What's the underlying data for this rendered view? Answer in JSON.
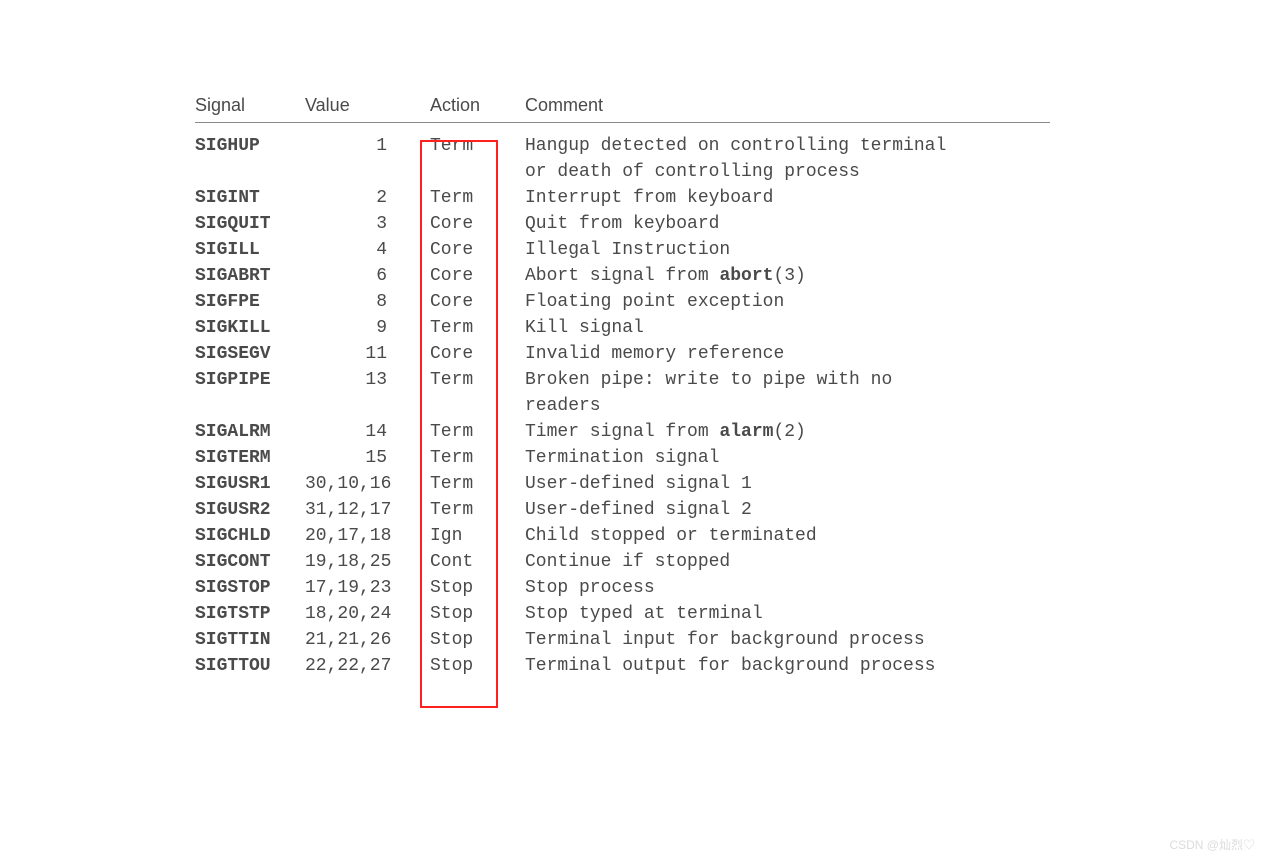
{
  "headers": {
    "signal": "Signal",
    "value": "Value",
    "action": "Action",
    "comment": "Comment"
  },
  "rows": [
    {
      "signal": "SIGHUP",
      "value": "1",
      "value_align": "right",
      "action": "Term",
      "comment_pre": "Hangup detected on controlling terminal",
      "comment_cont": "or death of controlling process"
    },
    {
      "signal": "SIGINT",
      "value": "2",
      "value_align": "right",
      "action": "Term",
      "comment_pre": "Interrupt from keyboard"
    },
    {
      "signal": "SIGQUIT",
      "value": "3",
      "value_align": "right",
      "action": "Core",
      "comment_pre": "Quit from keyboard"
    },
    {
      "signal": "SIGILL",
      "value": "4",
      "value_align": "right",
      "action": "Core",
      "comment_pre": "Illegal Instruction"
    },
    {
      "signal": "SIGABRT",
      "value": "6",
      "value_align": "right",
      "action": "Core",
      "comment_pre": "Abort signal from ",
      "bold": "abort",
      "comment_post": "(3)"
    },
    {
      "signal": "SIGFPE",
      "value": "8",
      "value_align": "right",
      "action": "Core",
      "comment_pre": "Floating point exception"
    },
    {
      "signal": "SIGKILL",
      "value": "9",
      "value_align": "right",
      "action": "Term",
      "comment_pre": "Kill signal"
    },
    {
      "signal": "SIGSEGV",
      "value": "11",
      "value_align": "right",
      "action": "Core",
      "comment_pre": "Invalid memory reference"
    },
    {
      "signal": "SIGPIPE",
      "value": "13",
      "value_align": "right",
      "action": "Term",
      "comment_pre": "Broken pipe: write to pipe with no",
      "comment_cont": "readers"
    },
    {
      "signal": "SIGALRM",
      "value": "14",
      "value_align": "right",
      "action": "Term",
      "comment_pre": "Timer signal from ",
      "bold": "alarm",
      "comment_post": "(2)"
    },
    {
      "signal": "SIGTERM",
      "value": "15",
      "value_align": "right",
      "action": "Term",
      "comment_pre": "Termination signal"
    },
    {
      "signal": "SIGUSR1",
      "value": "30,10,16",
      "value_align": "left",
      "action": "Term",
      "comment_pre": "User-defined signal 1"
    },
    {
      "signal": "SIGUSR2",
      "value": "31,12,17",
      "value_align": "left",
      "action": "Term",
      "comment_pre": "User-defined signal 2"
    },
    {
      "signal": "SIGCHLD",
      "value": "20,17,18",
      "value_align": "left",
      "action": "Ign",
      "comment_pre": "Child stopped or terminated"
    },
    {
      "signal": "SIGCONT",
      "value": "19,18,25",
      "value_align": "left",
      "action": "Cont",
      "comment_pre": "Continue if stopped"
    },
    {
      "signal": "SIGSTOP",
      "value": "17,19,23",
      "value_align": "left",
      "action": "Stop",
      "comment_pre": "Stop process"
    },
    {
      "signal": "SIGTSTP",
      "value": "18,20,24",
      "value_align": "left",
      "action": "Stop",
      "comment_pre": "Stop typed at terminal"
    },
    {
      "signal": "SIGTTIN",
      "value": "21,21,26",
      "value_align": "left",
      "action": "Stop",
      "comment_pre": "Terminal input for background process"
    },
    {
      "signal": "SIGTTOU",
      "value": "22,22,27",
      "value_align": "left",
      "action": "Stop",
      "comment_pre": "Terminal output for background process"
    }
  ],
  "watermark": "CSDN @灿烈♡"
}
